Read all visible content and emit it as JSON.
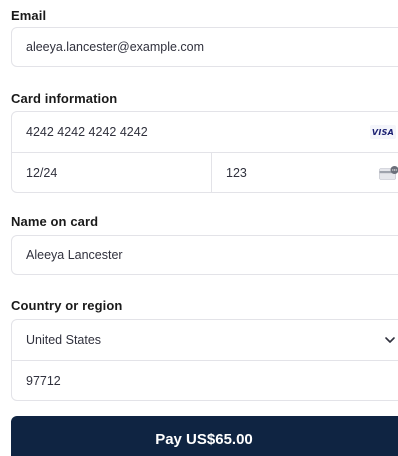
{
  "email": {
    "label": "Email",
    "value": "aleeya.lancester@example.com"
  },
  "card": {
    "label": "Card information",
    "number": "4242 4242 4242 4242",
    "brand": "VISA",
    "expiry": "12/24",
    "cvc": "123",
    "brand_icon": "visa-icon",
    "cvc_icon": "card-cvc-icon"
  },
  "name": {
    "label": "Name on card",
    "value": "Aleeya Lancester"
  },
  "country": {
    "label": "Country or region",
    "value": "United States",
    "postal": "97712",
    "dropdown_icon": "chevron-down-icon"
  },
  "pay_button": {
    "label": "Pay US$65.00"
  },
  "colors": {
    "button_bg": "#0f2442",
    "border": "#e3e3e8",
    "text": "#30313d"
  }
}
